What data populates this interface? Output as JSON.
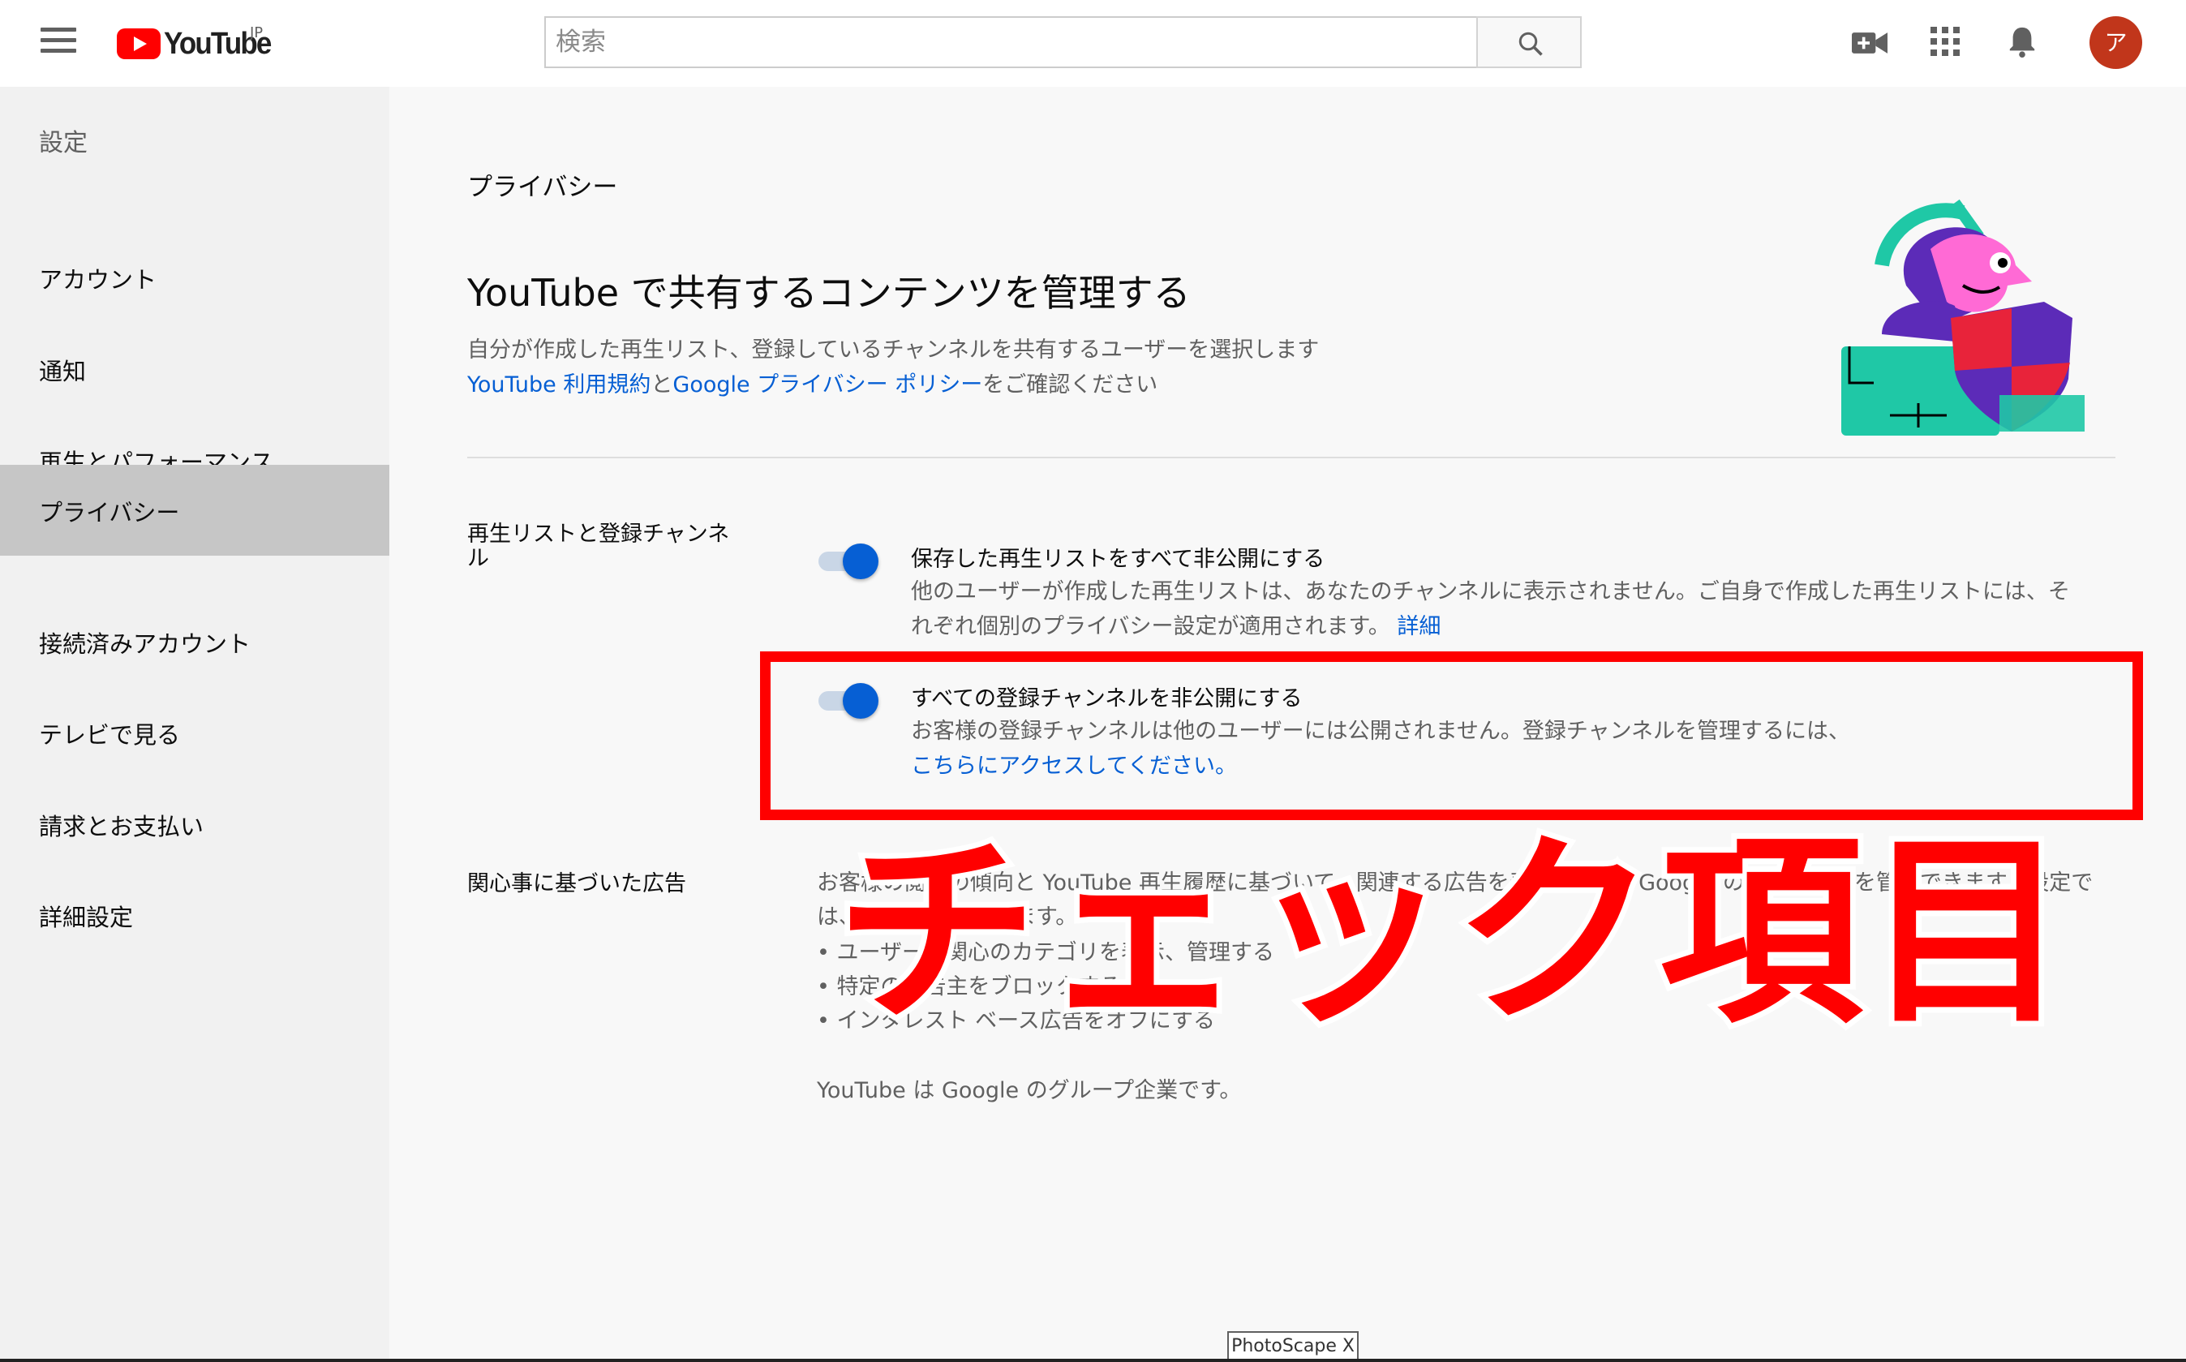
{
  "header": {
    "logo_text": "YouTube",
    "logo_region": "JP",
    "search_placeholder": "検索",
    "avatar_initial": "ア",
    "icons": [
      "menu-icon",
      "video-camera-plus-icon",
      "apps-grid-icon",
      "bell-icon",
      "search-icon"
    ]
  },
  "sidebar": {
    "title": "設定",
    "items": [
      {
        "label": "アカウント"
      },
      {
        "label": "通知"
      },
      {
        "label": "再生とパフォーマンス"
      },
      {
        "label": "プライバシー",
        "active": true
      },
      {
        "label": "接続済みアカウント"
      },
      {
        "label": "テレビで見る"
      },
      {
        "label": "請求とお支払い"
      },
      {
        "label": "詳細設定"
      }
    ]
  },
  "main": {
    "section_label": "プライバシー",
    "title": "YouTube で共有するコンテンツを管理する",
    "description": "自分が作成した再生リスト、登録しているチャンネルを共有するユーザーを選択します",
    "terms_link": "YouTube 利用規約",
    "and_text": "と",
    "policy_link": "Google プライバシー ポリシー",
    "confirm_text": "をご確認ください",
    "group_label": "再生リストと登録チャンネル",
    "options": [
      {
        "title": "保存した再生リストをすべて非公開にする",
        "desc_line1": "他のユーザーが作成した再生リストは、あなたのチャンネルに表示されません。ご自身で作成した再生リストには、そ",
        "desc_line2": "れぞれ個別のプライバシー設定が適用されます。",
        "link": "詳細",
        "enabled": true
      },
      {
        "title": "すべての登録チャンネルを非公開にする",
        "desc_line1": "お客様の登録チャンネルは他のユーザーには公開されません。登録チャンネルを管理するには、",
        "link": "こちらにアクセスしてください。",
        "enabled": true
      }
    ],
    "ads": {
      "label": "関心事に基づいた広告",
      "desc": "お客様の閲覧の傾向と YouTube 再生履歴に基づいて、関連する広告を表示します。Google の広告の設定を管理できます。設定では、次のことができます。",
      "list": [
        "• ユーザーの関心のカテゴリを表示、管理する",
        "• 特定の広告主をブロックする",
        "• インタレスト ベース広告をオフにする"
      ],
      "footer": "YouTube は Google のグループ企業です。"
    }
  },
  "overlay": {
    "text": "チェック項目",
    "color": "#ff0000"
  },
  "watermark": "PhotoScape X",
  "colors": {
    "accent": "#065fd4",
    "brand": "#ff0000",
    "avatar": "#c1361b",
    "highlight": "#ff0000"
  }
}
